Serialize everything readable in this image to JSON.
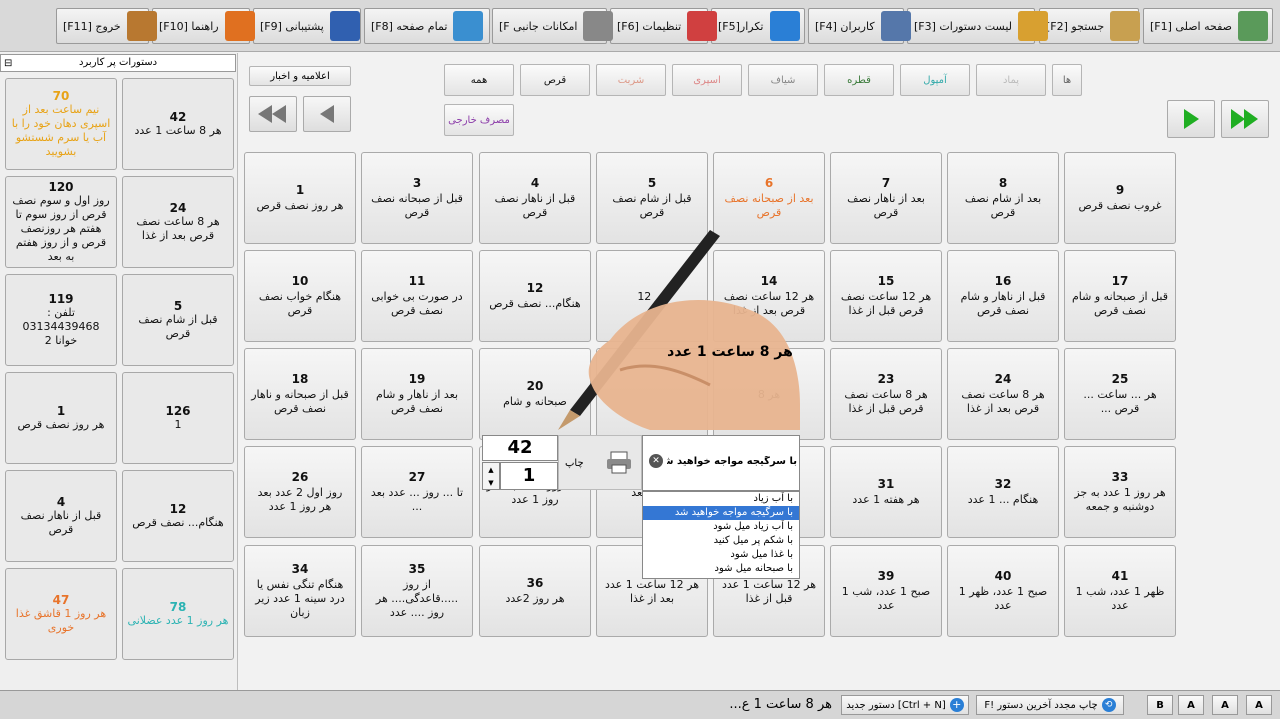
{
  "toolbar": {
    "buttons": [
      {
        "label": "[F1] صفحه اصلی",
        "icon": "home-icon"
      },
      {
        "label": "[F2] جستجو",
        "icon": "search-icon"
      },
      {
        "label": "[F3] لیست دستورات",
        "icon": "list-icon"
      },
      {
        "label": "[F4] کاربران",
        "icon": "users-icon"
      },
      {
        "label": "[F5]تکرار",
        "icon": "repeat-icon"
      },
      {
        "label": "[F6] تنظیمات",
        "icon": "settings-icon"
      },
      {
        "label": "[F امکانات جانبی",
        "icon": "tools-icon"
      },
      {
        "label": "[F8] تمام صفحه",
        "icon": "fullscreen-icon"
      },
      {
        "label": "[F9] پشتیبانی",
        "icon": "support-icon"
      },
      {
        "label": "[F10] راهنما",
        "icon": "help-icon"
      },
      {
        "label": "[F11] خروج",
        "icon": "exit-icon"
      }
    ]
  },
  "sidebar": {
    "title": "دستورات پر کاربرد",
    "cards": [
      {
        "num": "42",
        "text": "هر 8 ساعت 1 عدد",
        "color": "#111111"
      },
      {
        "num": "70",
        "text": "نیم ساعت بعد از اسپری دهان خود را با آب یا سرم شستشو بشویید",
        "color": "#e8a317"
      },
      {
        "num": "24",
        "text": "هر 8 ساعت نصف قرص بعد از غذا",
        "color": "#111111"
      },
      {
        "num": "120",
        "text": "روز اول و سوم نصف قرص از روز سوم تا هفتم هر روزنصف قرص و از روز هفتم به بعد",
        "color": "#111111"
      },
      {
        "num": "5",
        "text": "قبل از شام نصف قرص",
        "color": "#111111"
      },
      {
        "num": "119",
        "text": "تلفن : 03134439468 خوانا 2",
        "color": "#111111"
      },
      {
        "num": "126",
        "text": "1",
        "color": "#111111"
      },
      {
        "num": "1",
        "text": "هر روز نصف قرص",
        "color": "#111111"
      },
      {
        "num": "12",
        "text": "هنگام... نصف قرص",
        "color": "#111111"
      },
      {
        "num": "4",
        "text": "قبل از ناهار نصف قرص",
        "color": "#111111"
      },
      {
        "num": "78",
        "text": "هر روز 1 عدد عضلانی",
        "color": "#2bb3b3"
      },
      {
        "num": "47",
        "text": "هر روز 1 قاشق غذا خوری",
        "color": "#e8742b"
      }
    ]
  },
  "filters": {
    "row1": [
      "ها",
      "پماد",
      "آمپول",
      "قطره",
      "شیاف",
      "اسپری",
      "شربت",
      "قرص",
      "همه"
    ],
    "row2": [
      "مصرف خارجی"
    ],
    "news": "اعلامیه و اخبار"
  },
  "grid": [
    {
      "num": "9",
      "text": "غروب نصف قرص",
      "color": "#111111"
    },
    {
      "num": "8",
      "text": "بعد از شام نصف قرص",
      "color": "#111111"
    },
    {
      "num": "7",
      "text": "بعد از ناهار نصف قرص",
      "color": "#111111"
    },
    {
      "num": "6",
      "text": "بعد از صبحانه نصف قرص",
      "color": "#e8742b"
    },
    {
      "num": "5",
      "text": "قبل از شام نصف قرص",
      "color": "#111111"
    },
    {
      "num": "4",
      "text": "قبل از ناهار نصف قرص",
      "color": "#111111"
    },
    {
      "num": "3",
      "text": "قبل از صبحانه نصف قرص",
      "color": "#111111"
    },
    {
      "num": "1",
      "text": "هر روز نصف قرص",
      "color": "#111111"
    },
    {
      "num": "17",
      "text": "قبل از صبحانه و شام نصف قرص",
      "color": "#111111"
    },
    {
      "num": "16",
      "text": "قبل از ناهار و شام نصف قرص",
      "color": "#111111"
    },
    {
      "num": "15",
      "text": "هر 12 ساعت نصف قرص قبل از غذا",
      "color": "#111111"
    },
    {
      "num": "14",
      "text": "هر 12 ساعت نصف قرص بعد از غذا",
      "color": "#111111"
    },
    {
      "num": "",
      "text": "هر 12",
      "color": "#111111"
    },
    {
      "num": "12",
      "text": "هنگام... نصف قرص",
      "color": "#111111"
    },
    {
      "num": "11",
      "text": "در صورت بی خوابی نصف قرص",
      "color": "#111111"
    },
    {
      "num": "10",
      "text": "هنگام خواب نصف قرص",
      "color": "#111111"
    },
    {
      "num": "25",
      "text": "هر ... ساعت ... قرص ...",
      "color": "#111111"
    },
    {
      "num": "24",
      "text": "هر 8 ساعت نصف قرص بعد از غذا",
      "color": "#111111"
    },
    {
      "num": "23",
      "text": "هر 8 ساعت نصف قرص قبل از غذا",
      "color": "#111111"
    },
    {
      "num": "",
      "text": "هر 8",
      "color": "#111111"
    },
    {
      "num": "",
      "text": "",
      "color": "#111111"
    },
    {
      "num": "20",
      "text": "صبحانه و شام",
      "color": "#111111"
    },
    {
      "num": "19",
      "text": "بعد از ناهار و شام نصف قرص",
      "color": "#111111"
    },
    {
      "num": "18",
      "text": "قبل از صبحانه و ناهار نصف قرص",
      "color": "#111111"
    },
    {
      "num": "33",
      "text": "هر روز 1 عدد به جز دوشنبه و جمعه",
      "color": "#111111"
    },
    {
      "num": "32",
      "text": "هنگام ... 1 عدد",
      "color": "#111111"
    },
    {
      "num": "31",
      "text": "هر هفته 1 عدد",
      "color": "#111111"
    },
    {
      "num": "",
      "text": "یک",
      "color": "#111111"
    },
    {
      "num": "",
      "text": "نصف بعد",
      "color": "#111111"
    },
    {
      "num": "",
      "text": "تا 3 روز نصف بعد هر روز 1 عدد",
      "color": "#111111"
    },
    {
      "num": "27",
      "text": "تا ... روز ... عدد بعد ...",
      "color": "#111111"
    },
    {
      "num": "26",
      "text": "روز اول 2 عدد بعد هر روز 1 عدد",
      "color": "#111111"
    },
    {
      "num": "41",
      "text": "ظهر 1 عدد، شب 1 عدد",
      "color": "#111111"
    },
    {
      "num": "40",
      "text": "صبح 1 عدد، ظهر 1 عدد",
      "color": "#111111"
    },
    {
      "num": "39",
      "text": "صبح 1 عدد، شب 1 عدد",
      "color": "#111111"
    },
    {
      "num": "",
      "text": "هر 12 ساعت 1 عدد قبل از غذا",
      "color": "#111111"
    },
    {
      "num": "",
      "text": "هر 12 ساعت 1 عدد بعد از غذا",
      "color": "#111111"
    },
    {
      "num": "36",
      "text": "هر روز 2عدد",
      "color": "#111111"
    },
    {
      "num": "35",
      "text": "از روز .....قاعدگی.... هر روز .... عدد",
      "color": "#111111"
    },
    {
      "num": "34",
      "text": "هنگام تنگی نفس یا درد سینه 1 عدد زیر زبان",
      "color": "#111111"
    }
  ],
  "overlay": {
    "caption": "هر 8 ساعت 1 عدد",
    "qty_number": "42",
    "qty_count": "1",
    "print_label": "چاپ",
    "combo_value": "با سرگیجه مواجه خواهید شد",
    "dropdown": [
      "با آب زیاد",
      "با سرگیجه مواجه خواهید شد",
      "با آب زیاد میل شود",
      "با شکم پر میل کنید",
      "با غذا میل شود",
      "با صبحانه میل شود"
    ],
    "selected_index": 1
  },
  "statusbar": {
    "current": "هر 8 ساعت 1 ع...",
    "new_cmd": "دستور جدید [Ctrl + N]",
    "reprint": "F! چاپ مجدد آخرین دستور",
    "fonts": [
      "B",
      "A",
      "A",
      "A"
    ]
  }
}
